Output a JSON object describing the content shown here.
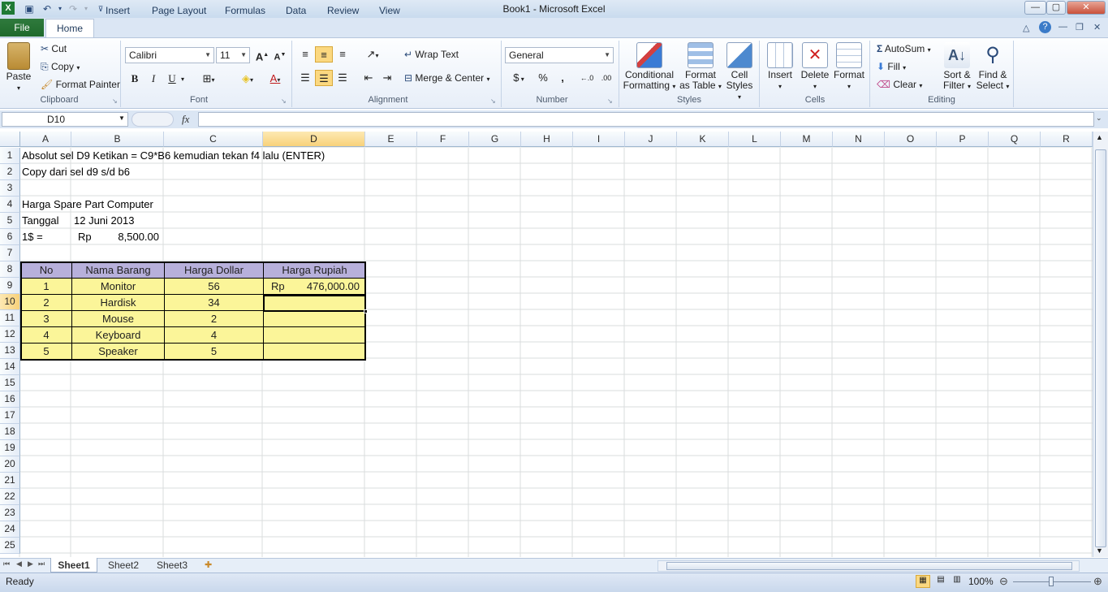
{
  "window": {
    "title": "Book1  -  Microsoft Excel"
  },
  "tabs": [
    "File",
    "Home",
    "Insert",
    "Page Layout",
    "Formulas",
    "Data",
    "Review",
    "View"
  ],
  "clipboard": {
    "paste": "Paste",
    "cut": "Cut",
    "copy": "Copy",
    "format_painter": "Format Painter",
    "label": "Clipboard"
  },
  "font": {
    "name": "Calibri",
    "size": "11",
    "label": "Font",
    "bold": "B",
    "italic": "I",
    "underline": "U"
  },
  "alignment": {
    "wrap_text": "Wrap Text",
    "merge_center": "Merge & Center",
    "label": "Alignment"
  },
  "number": {
    "format": "General",
    "label": "Number",
    "currency": "$",
    "percent": "%",
    "comma": ","
  },
  "styles": {
    "conditional": "Conditional",
    "formatting": "Formatting",
    "format_as": "Format",
    "as_table": "as Table",
    "cell": "Cell",
    "cell_styles": "Styles",
    "label": "Styles"
  },
  "cells": {
    "insert": "Insert",
    "delete": "Delete",
    "format": "Format",
    "label": "Cells"
  },
  "editing": {
    "autosum": "AutoSum",
    "fill": "Fill",
    "clear": "Clear",
    "sort": "Sort &",
    "filter": "Filter",
    "find": "Find &",
    "select": "Select",
    "label": "Editing"
  },
  "formula_bar": {
    "name_box": "D10",
    "fx": "fx",
    "formula": ""
  },
  "columns": [
    "A",
    "B",
    "C",
    "D",
    "E",
    "F",
    "G",
    "H",
    "I",
    "J",
    "K",
    "L",
    "M",
    "N",
    "O",
    "P",
    "Q",
    "R"
  ],
  "rows": [
    "1",
    "2",
    "3",
    "4",
    "5",
    "6",
    "7",
    "8",
    "9",
    "10",
    "11",
    "12",
    "13",
    "14",
    "15",
    "16",
    "17",
    "18",
    "19",
    "20",
    "21",
    "22",
    "23",
    "24",
    "25"
  ],
  "sheet": {
    "a1": "Absolut sel D9 Ketikan = C9*B6 kemudian tekan f4 lalu (ENTER)",
    "a2": "Copy dari sel d9 s/d b6",
    "a4": "Harga Spare Part Computer",
    "a5": "Tanggal",
    "b5": "12 Juni 2013",
    "a6": "1$ =",
    "b6_sym": "Rp",
    "b6_val": "8,500.00",
    "table_headers": [
      "No",
      "Nama Barang",
      "Harga Dollar",
      "Harga Rupiah"
    ],
    "table_rows": [
      {
        "no": "1",
        "nama": "Monitor",
        "dollar": "56",
        "rp_sym": "Rp",
        "rp_val": "476,000.00"
      },
      {
        "no": "2",
        "nama": "Hardisk",
        "dollar": "34",
        "rp_sym": "",
        "rp_val": ""
      },
      {
        "no": "3",
        "nama": "Mouse",
        "dollar": "2",
        "rp_sym": "",
        "rp_val": ""
      },
      {
        "no": "4",
        "nama": "Keyboard",
        "dollar": "4",
        "rp_sym": "",
        "rp_val": ""
      },
      {
        "no": "5",
        "nama": "Speaker",
        "dollar": "5",
        "rp_sym": "",
        "rp_val": ""
      }
    ]
  },
  "sheet_tabs": [
    "Sheet1",
    "Sheet2",
    "Sheet3"
  ],
  "status": {
    "ready": "Ready",
    "zoom": "100%"
  },
  "colors": {
    "table_header": "#b7b0db",
    "table_body": "#fbf599",
    "file_tab": "#2f7a3d",
    "selected_header": "#f8d17a"
  }
}
